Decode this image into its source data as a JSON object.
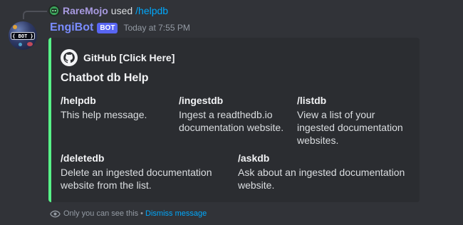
{
  "reply": {
    "user": "RareMojo",
    "used_text": "used",
    "command": "/helpdb",
    "avatar_icon": "robot-face-icon"
  },
  "message": {
    "author": "EngiBot",
    "badge": "BOT",
    "timestamp": "Today at 7:55 PM",
    "avatar_tag": "{ BOT }"
  },
  "embed": {
    "accent_color": "#57f287",
    "author_icon": "github-icon",
    "author_name": "GitHub [Click Here]",
    "title": "Chatbot db Help",
    "fields": [
      {
        "name": "/helpdb",
        "value": "This help message."
      },
      {
        "name": "/ingestdb",
        "value": "Ingest a readthedb.io documentation website."
      },
      {
        "name": "/listdb",
        "value": "View a list of your ingested documentation websites."
      },
      {
        "name": "/deletedb",
        "value": "Delete an ingested documentation website from the list."
      },
      {
        "name": "/askdb",
        "value": "Ask about an ingested documentation website."
      }
    ]
  },
  "ephemeral": {
    "icon": "eye-icon",
    "text": "Only you can see this",
    "separator": "•",
    "dismiss": "Dismiss message"
  },
  "colors": {
    "background": "#313338",
    "embed_bg": "#2b2d31",
    "link": "#00a8fc",
    "bot_badge": "#5865f2",
    "author_name": "#7a8cff"
  }
}
